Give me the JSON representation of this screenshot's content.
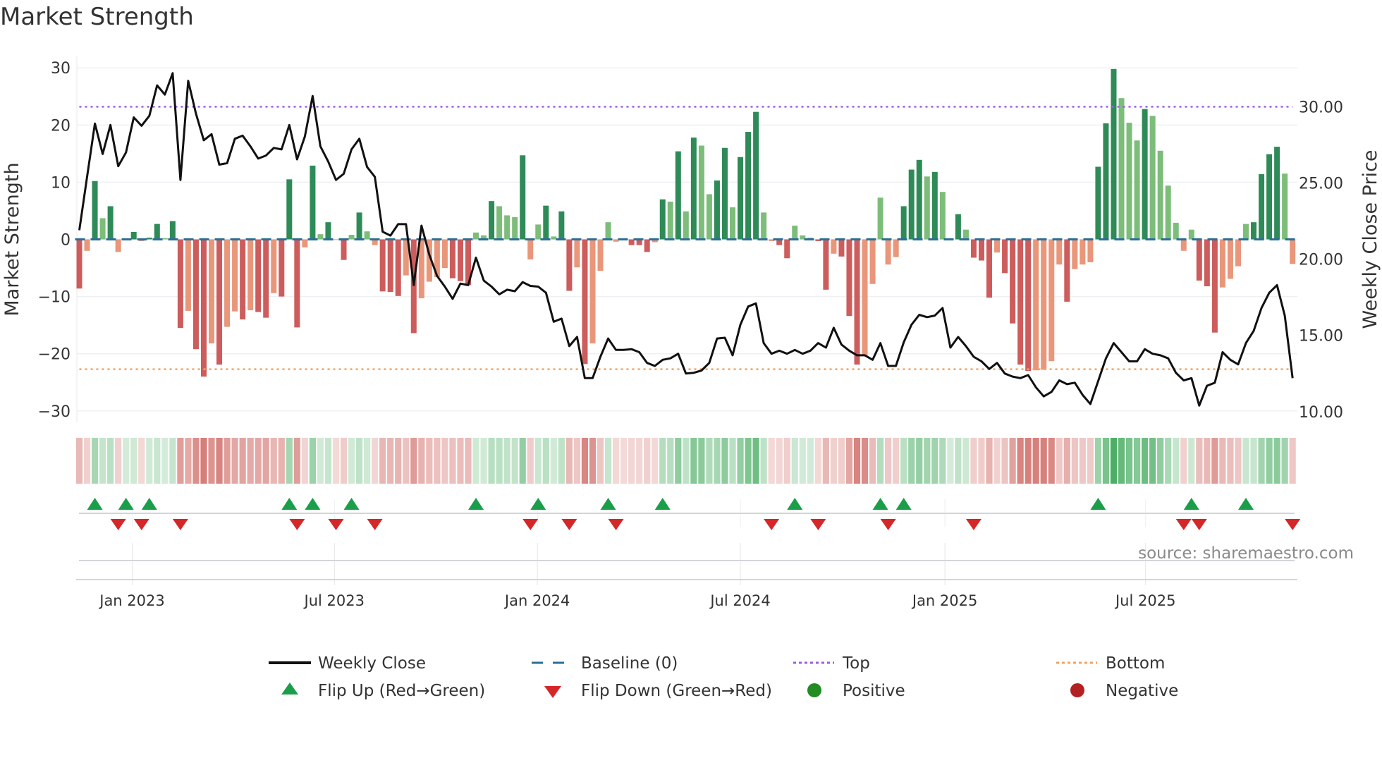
{
  "chart_data": {
    "type": "bar",
    "title": "Market Strength",
    "ylabel": "Market Strength",
    "y2label": "Weekly Close Price",
    "ylim": [
      -32,
      32
    ],
    "yticks": [
      30,
      20,
      10,
      0,
      -10,
      -20,
      -30
    ],
    "ytick_labels": [
      "30",
      "20",
      "10",
      "0",
      "−10",
      "−20",
      "−30"
    ],
    "y2ticks": [
      30,
      25,
      20,
      15,
      10
    ],
    "y2tick_labels": [
      "30.00",
      "25.00",
      "20.00",
      "15.00",
      "10.00"
    ],
    "y2_per_y": 0.375,
    "y2_at_top_line": 30,
    "top": 23.2,
    "bottom": -22.7,
    "baseline": 0,
    "xticks": [
      {
        "week": 6.8,
        "label": "Jan 2023"
      },
      {
        "week": 32.8,
        "label": "Jul 2023"
      },
      {
        "week": 58.9,
        "label": "Jan 2024"
      },
      {
        "week": 85.0,
        "label": "Jul 2024"
      },
      {
        "week": 111.3,
        "label": "Jan 2025"
      },
      {
        "week": 137.1,
        "label": "Jul 2025"
      }
    ],
    "strength": [
      -8.6,
      -2,
      10.2,
      3.7,
      5.8,
      -2.2,
      0.1,
      1.3,
      -0.3,
      0.3,
      2.7,
      0.2,
      3.2,
      -15.5,
      -12.5,
      -19.2,
      -24,
      -18.2,
      -21.9,
      -15.3,
      -12.6,
      -14,
      -12.4,
      -12.7,
      -13.7,
      -9.4,
      -10,
      10.5,
      -15.4,
      -1.4,
      12.9,
      0.9,
      3,
      -0.1,
      -3.6,
      0.8,
      4.7,
      1.4,
      -1,
      -9.1,
      -9.2,
      -9.9,
      -6.3,
      -16.4,
      -10.3,
      -7.4,
      -6.6,
      -5,
      -6.8,
      -7.3,
      -8,
      1.2,
      0.7,
      6.7,
      5.8,
      4.2,
      3.9,
      14.7,
      -3.5,
      2.6,
      5.9,
      0.5,
      4.9,
      -9,
      -4.9,
      -21.8,
      -18.2,
      -5.5,
      3,
      -0.4,
      -0.1,
      -1,
      -1,
      -2.2,
      -0.5,
      7,
      6.6,
      15.4,
      4.9,
      17.8,
      16.4,
      7.9,
      10.3,
      16,
      5.6,
      14.4,
      18.8,
      22.3,
      4.7,
      -0.3,
      -1,
      -3.3,
      2.4,
      0.7,
      0.3,
      -0.3,
      -8.8,
      -2.5,
      -3,
      -13.4,
      -21.9,
      -20.3,
      -7.8,
      7.3,
      -4.4,
      -3.1,
      5.8,
      12.2,
      13.9,
      11,
      11.8,
      8.3,
      0.2,
      4.4,
      1.7,
      -3.2,
      -3.7,
      -10.2,
      -2.3,
      -5.9,
      -14.7,
      -21.9,
      -23,
      -22.9,
      -22.8,
      -21.3,
      -4.4,
      -10.9,
      -5.2,
      -4.4,
      -4,
      12.7,
      20.3,
      29.8,
      24.7,
      20.4,
      17.3,
      22.8,
      21.6,
      15.5,
      9.4,
      2.9,
      -2,
      1.7,
      -7.2,
      -8.2,
      -16.3,
      -8.4,
      -6.9,
      -4.7,
      2.7,
      3,
      11.4,
      14.9,
      16.2,
      11.5,
      -4.3
    ],
    "weekly_close": [
      21.9,
      25.4,
      28.9,
      26.9,
      28.8,
      26.1,
      27.0,
      29.3,
      28.75,
      29.4,
      31.4,
      30.8,
      32.2,
      25.2,
      31.7,
      29.55,
      27.8,
      28.2,
      26.2,
      26.3,
      27.9,
      28.1,
      27.4,
      26.6,
      26.8,
      27.3,
      27.2,
      28.8,
      26.55,
      28.05,
      30.7,
      27.4,
      26.4,
      25.2,
      25.6,
      27.2,
      27.9,
      26.05,
      25.4,
      21.8,
      21.55,
      22.3,
      22.3,
      18.3,
      22.2,
      20.3,
      18.9,
      18.2,
      17.4,
      18.4,
      18.3,
      20.1,
      18.6,
      18.2,
      17.7,
      18.0,
      17.9,
      18.5,
      18.25,
      18.2,
      17.8,
      15.9,
      16.1,
      14.3,
      14.9,
      12.2,
      12.2,
      13.6,
      14.8,
      14.05,
      14.05,
      14.1,
      13.9,
      13.2,
      13.0,
      13.4,
      13.5,
      13.8,
      12.5,
      12.55,
      12.7,
      13.2,
      14.8,
      14.85,
      13.7,
      15.7,
      16.9,
      17.1,
      14.5,
      13.8,
      14.0,
      13.8,
      14.05,
      13.8,
      14.0,
      14.5,
      14.2,
      15.5,
      14.4,
      14.0,
      13.7,
      13.7,
      13.4,
      14.5,
      13.0,
      13.0,
      14.55,
      15.7,
      16.35,
      16.2,
      16.3,
      16.8,
      14.2,
      14.9,
      14.3,
      13.6,
      13.3,
      12.8,
      13.2,
      12.5,
      12.3,
      12.2,
      12.4,
      11.6,
      11.0,
      11.3,
      12.05,
      11.8,
      11.9,
      11.1,
      10.5,
      12.0,
      13.5,
      14.5,
      13.9,
      13.3,
      13.3,
      14.1,
      13.8,
      13.7,
      13.5,
      12.55,
      12.05,
      12.2,
      10.4,
      11.7,
      11.9,
      13.9,
      13.4,
      13.1,
      14.5,
      15.3,
      16.8,
      17.8,
      18.3,
      16.3,
      12.2
    ],
    "legend": {
      "placement": "bottom",
      "items": [
        {
          "label": "Weekly Close",
          "key": "line"
        },
        {
          "label": "Baseline (0)",
          "key": "dash"
        },
        {
          "label": "Top",
          "key": "top"
        },
        {
          "label": "Bottom",
          "key": "bottom"
        },
        {
          "label": "Flip Up (Red→Green)",
          "key": "up"
        },
        {
          "label": "Flip Down (Green→Red)",
          "key": "down"
        },
        {
          "label": "Positive",
          "key": "pos"
        },
        {
          "label": "Negative",
          "key": "neg"
        }
      ]
    },
    "source": "source: sharemaestro.com"
  },
  "colors": {
    "green_dark": "#2e8b57",
    "green_light": "#7dbd7a",
    "red_dark": "#cd5c5c",
    "red_light": "#e9967a",
    "line": "#111111",
    "baseline": "#2a6f97",
    "top": "#9b5de5",
    "bottom": "#f4a261",
    "flip_up": "#1a9e4a",
    "flip_down": "#d62728",
    "positive": "#228b22",
    "negative": "#b22222"
  }
}
